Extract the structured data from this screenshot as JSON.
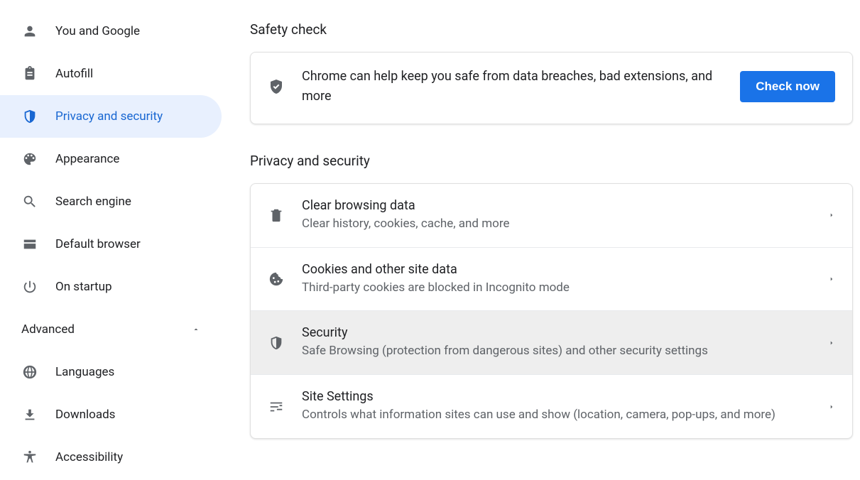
{
  "sidebar": {
    "items": [
      {
        "label": "You and Google",
        "icon": "person",
        "selected": false,
        "name": "sidebar-item-you-and-google"
      },
      {
        "label": "Autofill",
        "icon": "clipboard",
        "selected": false,
        "name": "sidebar-item-autofill"
      },
      {
        "label": "Privacy and security",
        "icon": "shield",
        "selected": true,
        "name": "sidebar-item-privacy-security"
      },
      {
        "label": "Appearance",
        "icon": "palette",
        "selected": false,
        "name": "sidebar-item-appearance"
      },
      {
        "label": "Search engine",
        "icon": "search",
        "selected": false,
        "name": "sidebar-item-search-engine"
      },
      {
        "label": "Default browser",
        "icon": "browser",
        "selected": false,
        "name": "sidebar-item-default-browser"
      },
      {
        "label": "On startup",
        "icon": "power",
        "selected": false,
        "name": "sidebar-item-on-startup"
      }
    ],
    "advanced_label": "Advanced",
    "advanced_items": [
      {
        "label": "Languages",
        "icon": "globe",
        "name": "sidebar-item-languages"
      },
      {
        "label": "Downloads",
        "icon": "download",
        "name": "sidebar-item-downloads"
      },
      {
        "label": "Accessibility",
        "icon": "accessibility",
        "name": "sidebar-item-accessibility"
      }
    ]
  },
  "safety_check": {
    "title": "Safety check",
    "description": "Chrome can help keep you safe from data breaches, bad extensions, and more",
    "button_label": "Check now"
  },
  "privacy": {
    "title": "Privacy and security",
    "rows": [
      {
        "title": "Clear browsing data",
        "sub": "Clear history, cookies, cache, and more",
        "icon": "trash",
        "name": "row-clear-browsing-data",
        "hover": false
      },
      {
        "title": "Cookies and other site data",
        "sub": "Third-party cookies are blocked in Incognito mode",
        "icon": "cookie",
        "name": "row-cookies",
        "hover": false
      },
      {
        "title": "Security",
        "sub": "Safe Browsing (protection from dangerous sites) and other security settings",
        "icon": "shield",
        "name": "row-security",
        "hover": true
      },
      {
        "title": "Site Settings",
        "sub": "Controls what information sites can use and show (location, camera, pop-ups, and more)",
        "icon": "tune",
        "name": "row-site-settings",
        "hover": false
      }
    ]
  }
}
